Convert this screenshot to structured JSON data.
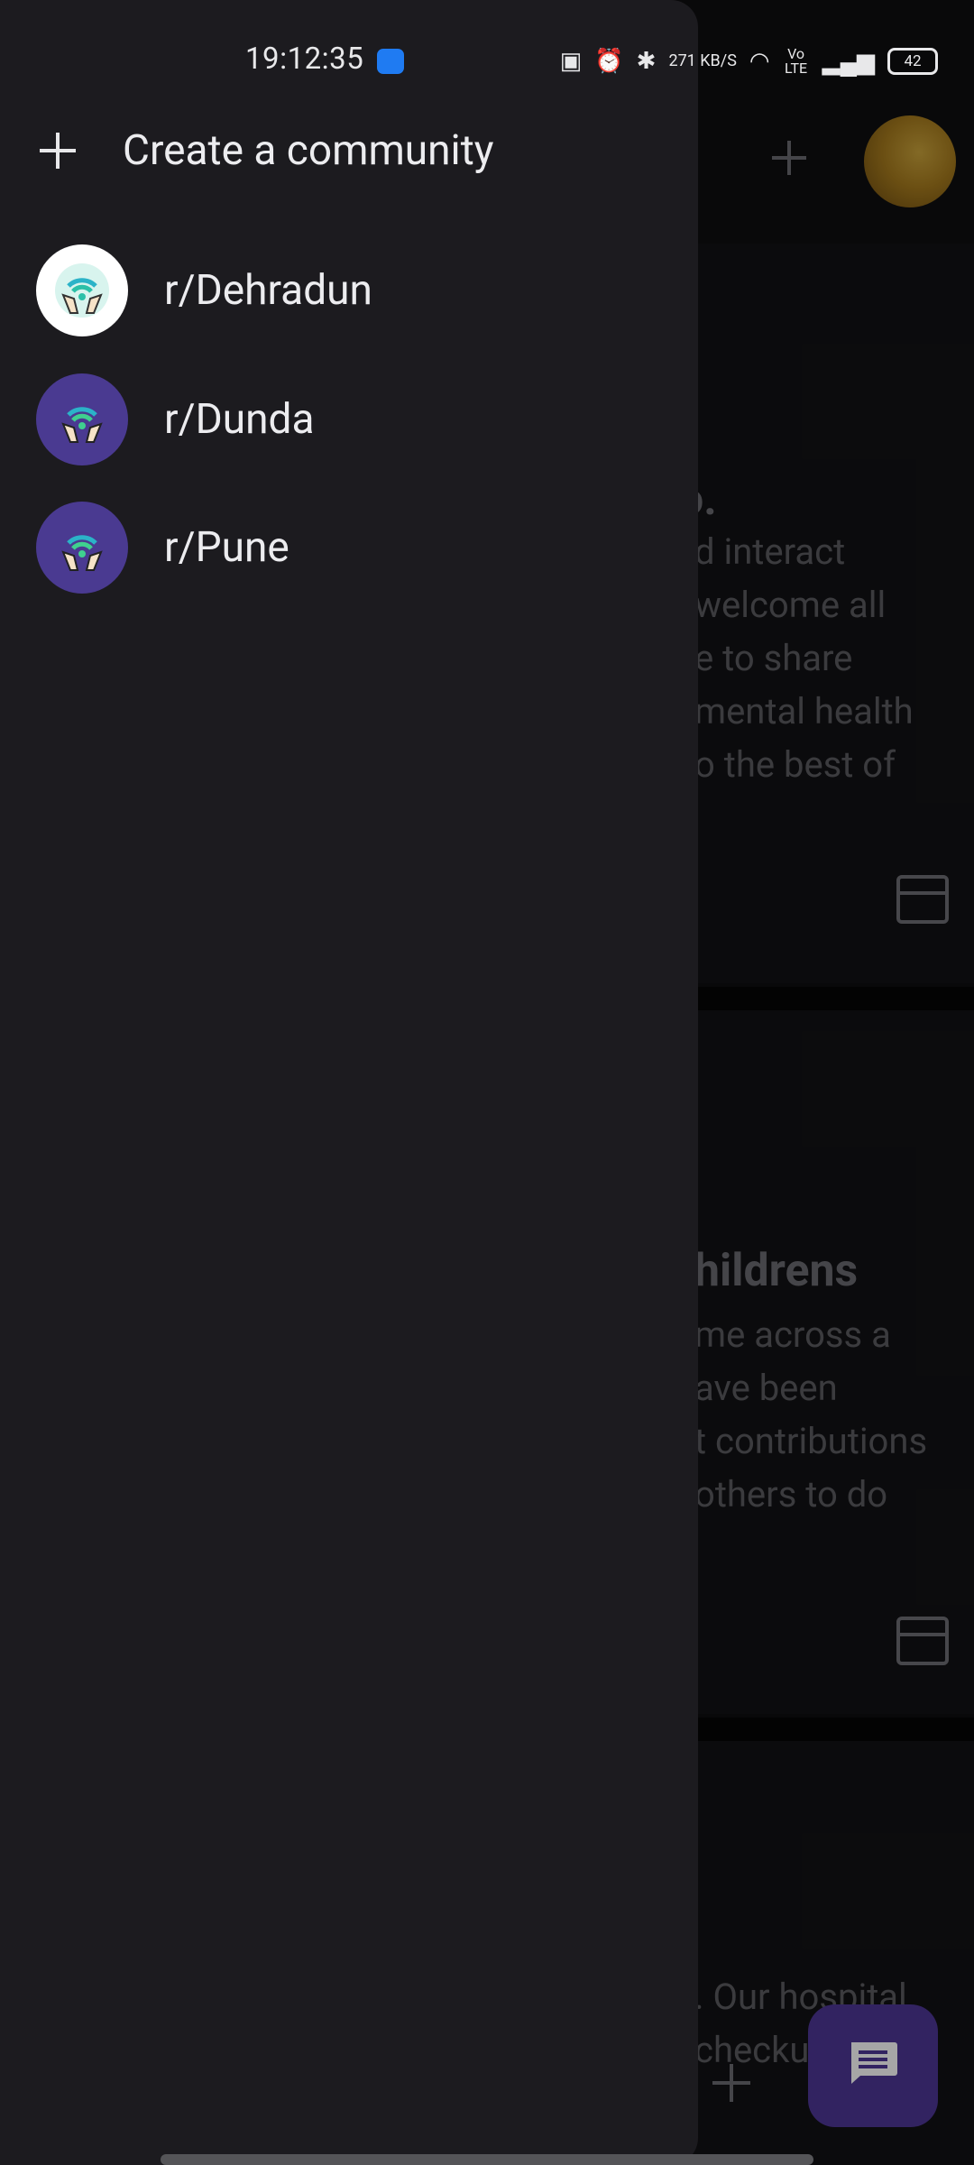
{
  "status": {
    "time": "19:12:35",
    "network_speed": "271 KB/S",
    "volte": "Vo LTE",
    "battery": "42"
  },
  "drawer": {
    "create_label": "Create a community",
    "communities": [
      {
        "name": "r/Dehradun",
        "avatar_style": "white"
      },
      {
        "name": "r/Dunda",
        "avatar_style": "purple"
      },
      {
        "name": "r/Pune",
        "avatar_style": "purple"
      }
    ]
  },
  "background": {
    "card1": {
      "title_fragment": "o.",
      "lines": [
        "d interact",
        "welcome all",
        "e to share",
        "mental health",
        "o the best of"
      ]
    },
    "card2": {
      "title_fragment": "hildrens",
      "lines": [
        "me across a",
        "ave been",
        "t contributions",
        " others to do"
      ]
    },
    "card3": {
      "lines": [
        ". Our hospital",
        "checkup"
      ]
    }
  },
  "icons": {
    "create": "plus-icon",
    "fab": "chat-icon",
    "calendar": "calendar-icon",
    "community_avatar": "helping-hands-wifi-icon"
  },
  "colors": {
    "drawer_bg": "#1c1b1f",
    "fab_bg": "#4e3796",
    "avatar_purple": "#4a3a91"
  }
}
